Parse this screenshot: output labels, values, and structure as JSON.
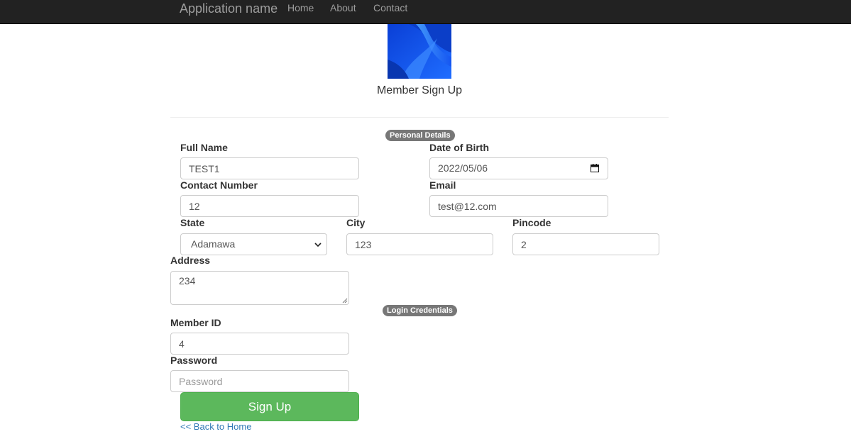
{
  "navbar": {
    "brand": "Application name",
    "links": [
      "Home",
      "About",
      "Contact"
    ]
  },
  "page": {
    "title": "Member Sign Up"
  },
  "sections": {
    "personal": "Personal Details",
    "login": "Login Credentials"
  },
  "form": {
    "full_name": {
      "label": "Full Name",
      "value": "TEST1"
    },
    "dob": {
      "label": "Date of Birth",
      "value": "2022/05/06"
    },
    "contact": {
      "label": "Contact Number",
      "value": "12"
    },
    "email": {
      "label": "Email",
      "value": "test@12.com"
    },
    "state": {
      "label": "State",
      "value": "Adamawa"
    },
    "city": {
      "label": "City",
      "value": "123"
    },
    "pincode": {
      "label": "Pincode",
      "value": "2"
    },
    "address": {
      "label": "Address",
      "value": "234"
    },
    "member_id": {
      "label": "Member ID",
      "value": "4"
    },
    "password": {
      "label": "Password",
      "placeholder": "Password"
    }
  },
  "actions": {
    "signup": "Sign Up",
    "back": "<< Back to Home"
  },
  "colors": {
    "navbar_bg": "#222222",
    "nav_text": "#9d9d9d",
    "badge_bg": "#777777",
    "success": "#5cb85c",
    "link": "#337ab7"
  },
  "icons": {
    "date": "calendar-icon",
    "select": "chevron-down-icon"
  }
}
